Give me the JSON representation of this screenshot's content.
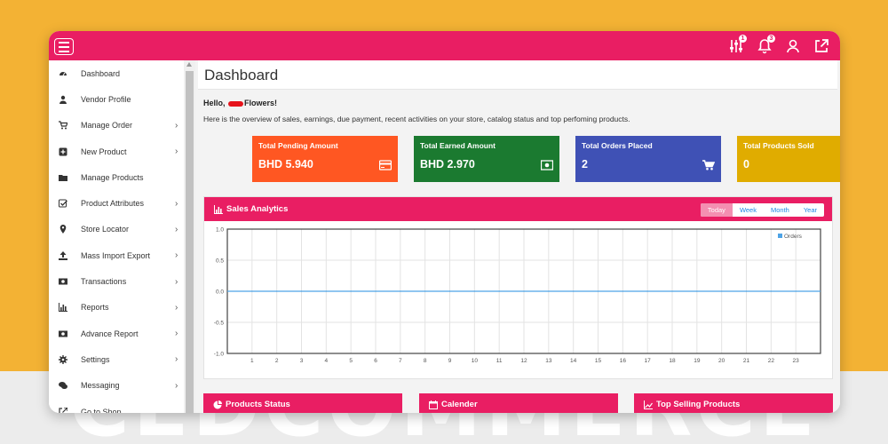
{
  "topbar": {
    "color": "#e91e63",
    "icons": [
      {
        "name": "filter-sliders-icon",
        "badge": "1"
      },
      {
        "name": "bell-icon",
        "badge": "3"
      },
      {
        "name": "user-icon",
        "badge": ""
      },
      {
        "name": "external-link-icon",
        "badge": ""
      }
    ]
  },
  "sidebar": {
    "items": [
      {
        "label": "Dashboard",
        "icon": "dashboard-gauge-icon",
        "chevron": ""
      },
      {
        "label": "Vendor Profile",
        "icon": "user-icon",
        "chevron": ""
      },
      {
        "label": "Manage Order",
        "icon": "cart-icon",
        "chevron": "›"
      },
      {
        "label": "New Product",
        "icon": "plus-square-icon",
        "chevron": "›"
      },
      {
        "label": "Manage Products",
        "icon": "folder-icon",
        "chevron": ""
      },
      {
        "label": "Product Attributes",
        "icon": "checkbox-icon",
        "chevron": "›"
      },
      {
        "label": "Store Locator",
        "icon": "map-marker-icon",
        "chevron": "›"
      },
      {
        "label": "Mass Import Export",
        "icon": "upload-icon",
        "chevron": "›"
      },
      {
        "label": "Transactions",
        "icon": "money-icon",
        "chevron": "›"
      },
      {
        "label": "Reports",
        "icon": "bar-chart-icon",
        "chevron": "›"
      },
      {
        "label": "Advance Report",
        "icon": "money-icon",
        "chevron": "›"
      },
      {
        "label": "Settings",
        "icon": "gear-icon",
        "chevron": "›"
      },
      {
        "label": "Messaging",
        "icon": "comments-icon",
        "chevron": "›"
      },
      {
        "label": "Go to Shop",
        "icon": "external-link-icon",
        "chevron": ""
      }
    ]
  },
  "main": {
    "page_title": "Dashboard",
    "hello_prefix": "Hello,",
    "hello_suffix": "Flowers!",
    "overview": "Here is the overview of sales, earnings, due payment, recent activities on your store, catalog status and top perfoming products.",
    "cards": [
      {
        "title": "Total Pending Amount",
        "value": "BHD 5.940",
        "icon": "credit-card-icon",
        "color": "#ff5722"
      },
      {
        "title": "Total Earned Amount",
        "value": "BHD 2.970",
        "icon": "money-icon",
        "color": "#1b7a30"
      },
      {
        "title": "Total Orders Placed",
        "value": "2",
        "icon": "cart-icon",
        "color": "#3f51b5"
      },
      {
        "title": "Total Products Sold",
        "value": "0",
        "icon": "bar-chart-icon",
        "color": "#e0ac00"
      }
    ],
    "analytics": {
      "title": "Sales Analytics",
      "tabs": [
        "Today",
        "Week",
        "Month",
        "Year"
      ],
      "active_tab": "Today"
    },
    "bottom_panels": [
      {
        "title": "Products Status",
        "icon": "pie-chart-icon"
      },
      {
        "title": "Calender",
        "icon": "calendar-icon"
      },
      {
        "title": "Top Selling Products",
        "icon": "line-chart-icon"
      }
    ]
  },
  "chart_data": {
    "type": "line",
    "x": [
      1,
      2,
      3,
      4,
      5,
      6,
      7,
      8,
      9,
      10,
      11,
      12,
      13,
      14,
      15,
      16,
      17,
      18,
      19,
      20,
      21,
      22,
      23
    ],
    "series": [
      {
        "name": "Orders",
        "values": [
          0,
          0,
          0,
          0,
          0,
          0,
          0,
          0,
          0,
          0,
          0,
          0,
          0,
          0,
          0,
          0,
          0,
          0,
          0,
          0,
          0,
          0,
          0
        ],
        "color": "#4da3e6"
      }
    ],
    "ylim": [
      -1.0,
      1.0
    ],
    "yticks": [
      "1.0",
      "0.5",
      "0.0",
      "-0.5",
      "-1.0"
    ],
    "xlim": [
      0,
      24
    ],
    "grid": true,
    "legend": "top-right"
  },
  "watermark": "CEDCOMMERCE"
}
